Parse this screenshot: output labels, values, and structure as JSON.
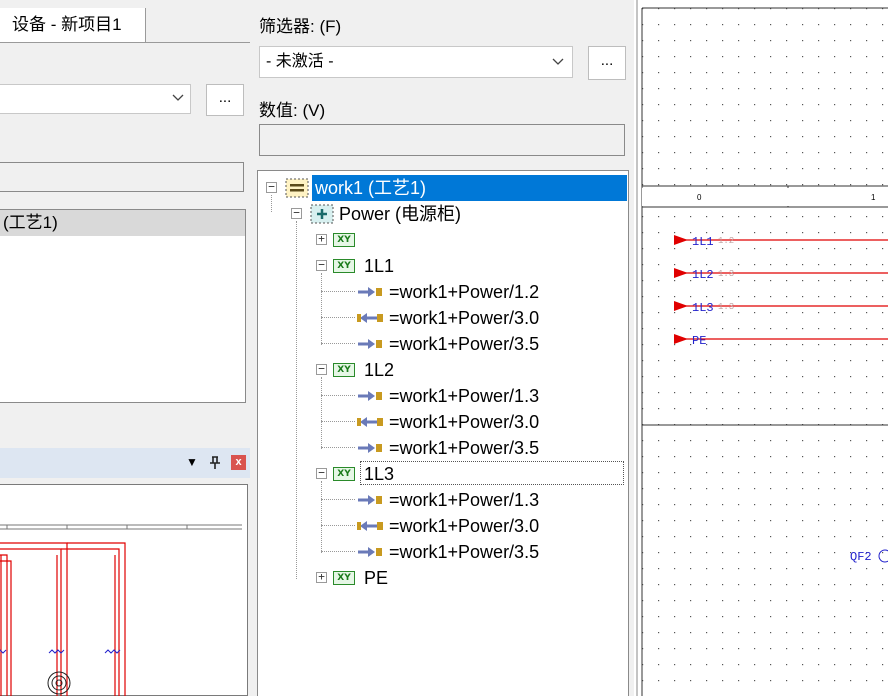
{
  "left_panel": {
    "tab_label": "设备 - 新项目1",
    "dots_label": "...",
    "list_item": "(工艺1)",
    "panel_buttons": {
      "dropdown": "▼",
      "pin": "🖈",
      "close": "x"
    }
  },
  "middle_panel": {
    "filter_label": "筛选器: (F)",
    "filter_value": "- 未激活 -",
    "dots_label": "...",
    "value_label": "数值: (V)",
    "tree": {
      "root": "work1 (工艺1)",
      "power": "Power (电源柜)",
      "groups": [
        {
          "label": "",
          "expanded": false
        },
        {
          "label": "1L1",
          "expanded": true,
          "children": [
            "=work1+Power/1.2",
            "=work1+Power/3.0",
            "=work1+Power/3.5"
          ]
        },
        {
          "label": "1L2",
          "expanded": true,
          "children": [
            "=work1+Power/1.3",
            "=work1+Power/3.0",
            "=work1+Power/3.5"
          ]
        },
        {
          "label": "1L3",
          "expanded": true,
          "children": [
            "=work1+Power/1.3",
            "=work1+Power/3.0",
            "=work1+Power/3.5"
          ]
        },
        {
          "label": "PE",
          "expanded": false
        }
      ],
      "xy_icon_text": "XY"
    }
  },
  "right_panel": {
    "ruler_marks": [
      "0",
      "1"
    ],
    "lines": [
      {
        "label": "1L1",
        "ref": "1.2"
      },
      {
        "label": "1L2",
        "ref": "1.3"
      },
      {
        "label": "1L3",
        "ref": "1.3"
      },
      {
        "label": "PE",
        "ref": ""
      }
    ],
    "component_label": "QF2"
  },
  "colors": {
    "selection": "#0078d7",
    "wire_red": "#e00000",
    "label_blue": "#2222cc"
  }
}
